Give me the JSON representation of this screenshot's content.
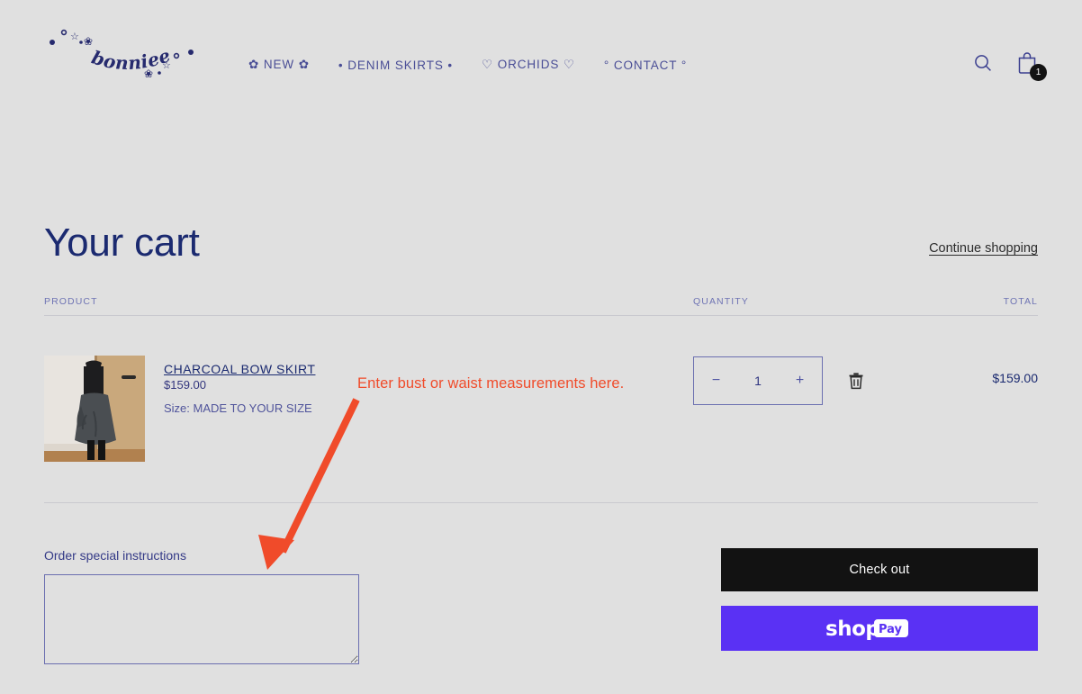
{
  "header": {
    "logo_text": "bonniee",
    "logo_name": "bonniee-logo",
    "nav": [
      {
        "label": "✿ NEW ✿",
        "name": "nav-new"
      },
      {
        "label": "• DENIM SKIRTS •",
        "name": "nav-denim-skirts"
      },
      {
        "label": "♡ ORCHIDS ♡",
        "name": "nav-orchids"
      },
      {
        "label": "° CONTACT °",
        "name": "nav-contact"
      }
    ],
    "search_icon": "search-icon",
    "cart_icon": "shopping-bag-icon",
    "cart_count": "1"
  },
  "cart": {
    "title": "Your cart",
    "continue_shopping": "Continue shopping",
    "columns": {
      "product": "PRODUCT",
      "quantity": "QUANTITY",
      "total": "TOTAL"
    },
    "items": [
      {
        "title": "CHARCOAL BOW SKIRT",
        "price": "$159.00",
        "variant": "Size: MADE TO YOUR SIZE",
        "quantity": "1",
        "decrease_label": "−",
        "increase_label": "+",
        "remove_icon": "trash-icon",
        "line_total": "$159.00"
      }
    ]
  },
  "footer": {
    "notes_label": "Order special instructions",
    "notes_value": "",
    "notes_placeholder": "",
    "checkout_label": "Check out",
    "shop_pay_label": "shop Pay"
  },
  "annotation": {
    "text": "Enter bust or waist measurements here.",
    "color": "#f04b2a",
    "arrow_name": "red-arrow-annotation"
  },
  "colors": {
    "background": "#e0e0e0",
    "navy": "#1b2a70",
    "accent_red": "#f04b2a",
    "shop_pay_purple": "#5a31f4",
    "checkout_black": "#121212"
  }
}
